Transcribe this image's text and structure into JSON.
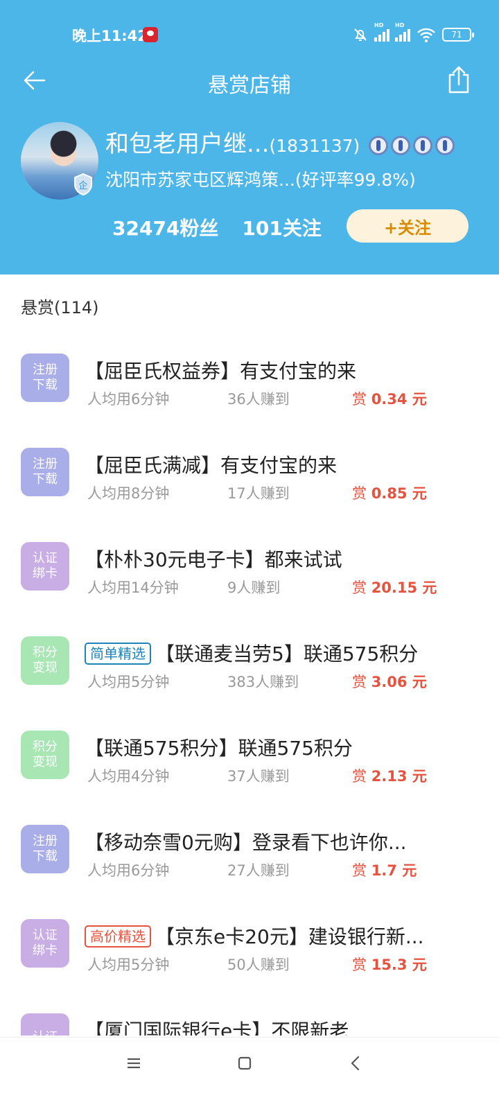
{
  "status_bar": {
    "time": "晚上11:42",
    "battery": "71",
    "net_type": "HD"
  },
  "nav": {
    "title": "悬赏店铺"
  },
  "shop": {
    "name": "和包老用户继...",
    "id": "(1831137)",
    "subtitle": "沈阳市苏家屯区辉鸿策...(好评率99.8%)",
    "enterprise_badge": "企",
    "fans": "32474粉丝",
    "following": "101关注",
    "follow_label": "+关注"
  },
  "section": {
    "title": "悬赏(114)"
  },
  "tasks": [
    {
      "tag": "注册下载",
      "tag_color": "#a9aee8",
      "badge": "",
      "title": "【屈臣氏权益券】有支付宝的来",
      "time": "人均用6分钟",
      "count": "36人赚到",
      "reward_prefix": "赏",
      "reward": "0.34 元"
    },
    {
      "tag": "注册下载",
      "tag_color": "#a9aee8",
      "badge": "",
      "title": "【屈臣氏满减】有支付宝的来",
      "time": "人均用8分钟",
      "count": "17人赚到",
      "reward_prefix": "赏",
      "reward": "0.85 元"
    },
    {
      "tag": "认证绑卡",
      "tag_color": "#c9aee6",
      "badge": "",
      "title": "【朴朴30元电子卡】都来试试",
      "time": "人均用14分钟",
      "count": "9人赚到",
      "reward_prefix": "赏",
      "reward": "20.15 元"
    },
    {
      "tag": "积分变现",
      "tag_color": "#a8e6b4",
      "badge": "简单精选",
      "badge_color": "#1c84b8",
      "title": "【联通麦当劳5】联通575积分",
      "time": "人均用5分钟",
      "count": "383人赚到",
      "reward_prefix": "赏",
      "reward": "3.06 元"
    },
    {
      "tag": "积分变现",
      "tag_color": "#a8e6b4",
      "badge": "",
      "title": "【联通575积分】联通575积分",
      "time": "人均用4分钟",
      "count": "37人赚到",
      "reward_prefix": "赏",
      "reward": "2.13 元"
    },
    {
      "tag": "注册下载",
      "tag_color": "#a9aee8",
      "badge": "",
      "title": "【移动奈雪0元购】登录看下也许你...",
      "time": "人均用6分钟",
      "count": "27人赚到",
      "reward_prefix": "赏",
      "reward": "1.7 元"
    },
    {
      "tag": "认证绑卡",
      "tag_color": "#c9aee6",
      "badge": "高价精选",
      "badge_color": "#e5533f",
      "title": "【京东e卡20元】建设银行新...",
      "time": "人均用5分钟",
      "count": "50人赚到",
      "reward_prefix": "赏",
      "reward": "15.3 元"
    },
    {
      "tag": "认证",
      "tag_color": "#c9aee6",
      "badge": "",
      "title": "【厦门国际银行e卡】不限新老",
      "time": "",
      "count": "",
      "reward_prefix": "",
      "reward": ""
    }
  ],
  "bottom_nav": {
    "icons": [
      "menu-icon",
      "home-square-icon",
      "back-chevron-icon"
    ]
  }
}
